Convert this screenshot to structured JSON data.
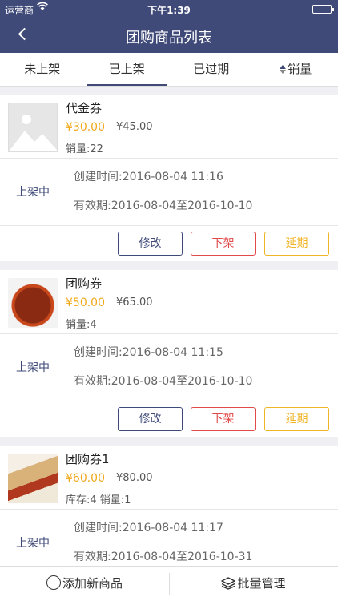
{
  "status_bar": {
    "carrier": "运营商",
    "time": "下午1:39"
  },
  "nav": {
    "title": "团购商品列表"
  },
  "tabs": [
    {
      "label": "未上架"
    },
    {
      "label": "已上架"
    },
    {
      "label": "已过期"
    },
    {
      "label": "销量"
    }
  ],
  "products": [
    {
      "name": "代金券",
      "price": "¥30.00",
      "original_price": "¥45.00",
      "meta": "销量:22",
      "image": "image-placeholder-icon",
      "state": "上架中",
      "created": "创建时间:2016-08-04 11:16",
      "validity": "有效期:2016-08-04至2016-10-10",
      "actions": {
        "edit": "修改",
        "delist": "下架",
        "extend": "延期"
      }
    },
    {
      "name": "团购券",
      "price": "¥50.00",
      "original_price": "¥65.00",
      "meta": "销量:4",
      "image": "braised-pork-dish",
      "state": "上架中",
      "created": "创建时间:2016-08-04 11:15",
      "validity": "有效期:2016-08-04至2016-10-10",
      "actions": {
        "edit": "修改",
        "delist": "下架",
        "extend": "延期"
      }
    },
    {
      "name": "团购券1",
      "price": "¥60.00",
      "original_price": "¥80.00",
      "meta": "库存:4 销量:1",
      "image": "spaghetti-dish",
      "state": "上架中",
      "created": "创建时间:2016-08-04 11:17",
      "validity": "有效期:2016-08-04至2016-10-31"
    }
  ],
  "bottom_bar": {
    "add_label": "添加新商品",
    "batch_label": "批量管理"
  },
  "colors": {
    "primary": "#3f4a78",
    "price": "#f0a81a",
    "danger": "#e24a4a",
    "warning": "#f0b427"
  }
}
